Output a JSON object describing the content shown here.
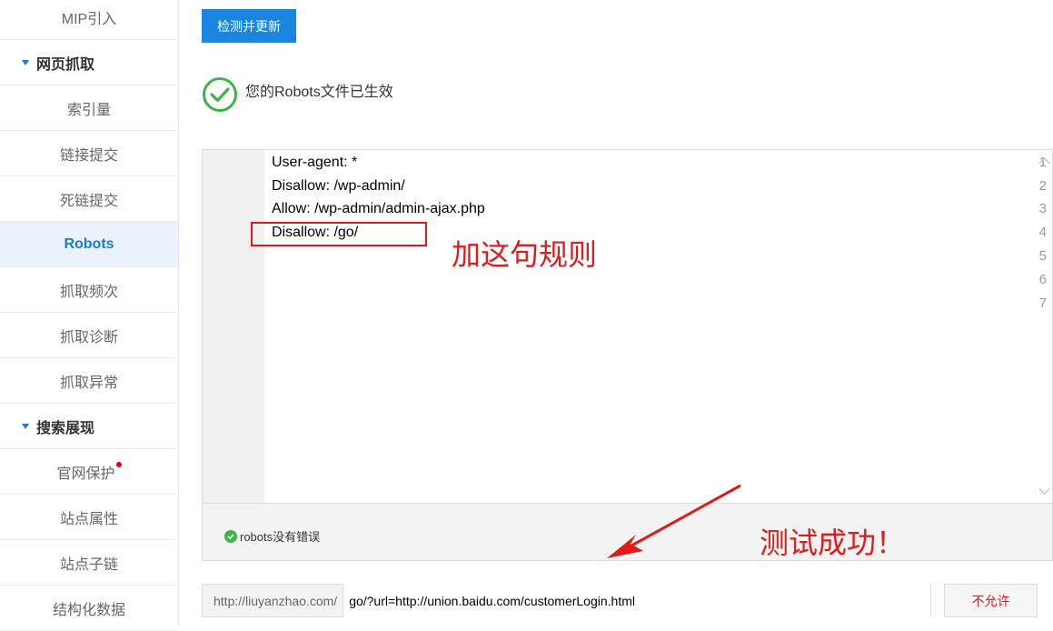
{
  "sidebar": {
    "items": [
      {
        "label": "MIP引入"
      },
      {
        "label": "网页抓取",
        "group": true
      },
      {
        "label": "索引量"
      },
      {
        "label": "链接提交"
      },
      {
        "label": "死链提交"
      },
      {
        "label": "Robots",
        "active": true
      },
      {
        "label": "抓取频次"
      },
      {
        "label": "抓取诊断"
      },
      {
        "label": "抓取异常"
      },
      {
        "label": "搜索展现",
        "group": true
      },
      {
        "label": "官网保护",
        "badge": "red-dot"
      },
      {
        "label": "站点属性"
      },
      {
        "label": "站点子链"
      },
      {
        "label": "结构化数据"
      }
    ]
  },
  "main": {
    "check_button": "检测并更新",
    "status_text": "您的Robots文件已生效",
    "editor": {
      "line_numbers": [
        "1",
        "2",
        "3",
        "4",
        "5",
        "6",
        "7"
      ],
      "lines": [
        "User-agent: *",
        "Disallow: /wp-admin/",
        "Allow: /wp-admin/admin-ajax.php",
        "Disallow: /go/",
        "",
        "",
        ""
      ]
    },
    "annotation_rule": "加这句规则",
    "annotation_success": "测试成功！",
    "robots_ok": "robots没有错误",
    "url_prefix": "http://liuyanzhao.com/",
    "url_value": "go/?url=http://union.baidu.com/customerLogin.html",
    "deny_button": "不允许"
  },
  "colors": {
    "accent": "#1a86e0",
    "annotation": "#e21a1a",
    "success": "#3ab54a"
  }
}
